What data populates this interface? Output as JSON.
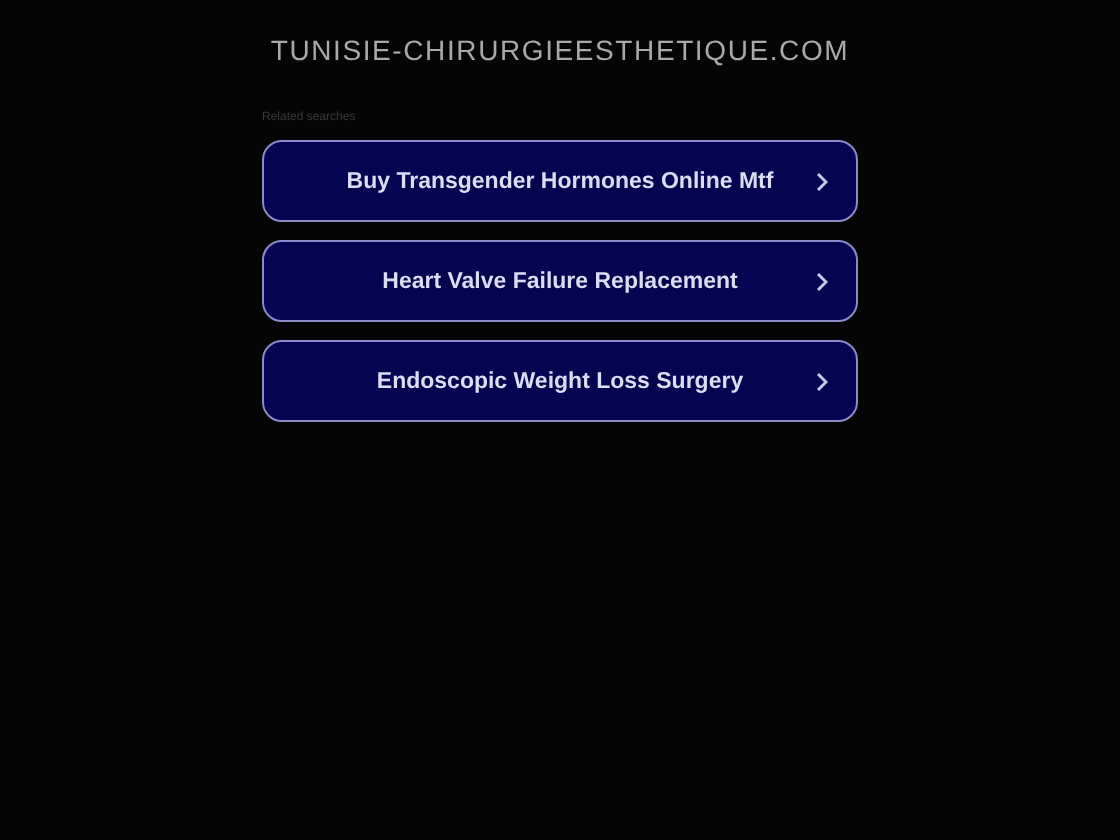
{
  "site_title": "TUNISIE-CHIRURGIEESTHETIQUE.COM",
  "related_label": "Related searches",
  "links": [
    {
      "label": "Buy Transgender Hormones Online Mtf"
    },
    {
      "label": "Heart Valve Failure Replacement"
    },
    {
      "label": "Endoscopic Weight Loss Surgery"
    }
  ]
}
